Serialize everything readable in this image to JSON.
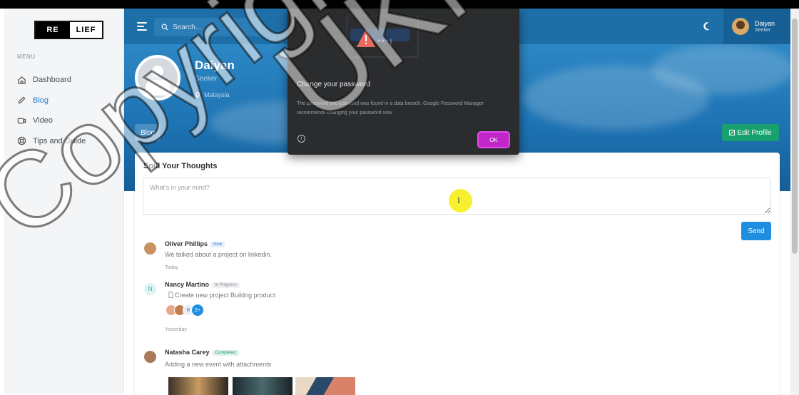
{
  "logo": {
    "left": "RE",
    "right": "LIEF"
  },
  "sidebar": {
    "menu_heading": "MENU",
    "items": [
      {
        "label": "Dashboard",
        "icon": "home-icon",
        "active": false
      },
      {
        "label": "Blog",
        "icon": "pencil-icon",
        "active": true
      },
      {
        "label": "Video",
        "icon": "video-icon",
        "active": false
      },
      {
        "label": "Tips and Guide",
        "icon": "lifebuoy-icon",
        "active": false
      }
    ]
  },
  "header": {
    "search_placeholder": "Search...",
    "user": {
      "name": "Daiyan",
      "role": "Seeker"
    }
  },
  "profile": {
    "name": "Daiyan",
    "role": "Seeker",
    "location": "Malaysia",
    "tab_label": "Blog",
    "edit_label": "Edit Profile"
  },
  "post_box": {
    "title": "Spill Your Thoughts",
    "placeholder": "What's in your mind?",
    "send_label": "Send"
  },
  "feed": [
    {
      "name": "Oliver Phillips",
      "badge": "New",
      "badge_color": "#e3effc",
      "badge_text": "#3b7ddd",
      "message": "We talked about a project on linkedin.",
      "time": "Today"
    },
    {
      "name": "Nancy Martino",
      "badge": "In Progress",
      "badge_color": "#eef0f2",
      "badge_text": "#8a8f96",
      "message": "Create new project Buildng product",
      "time": "Yesterday",
      "avatar_letter": "N",
      "stack_letter": "R",
      "stack_more": "2+"
    },
    {
      "name": "Natasha Carey",
      "badge": "Completed",
      "badge_color": "#dff3ea",
      "badge_text": "#1f9d6b",
      "message": "Adding a new event with attachments"
    }
  ],
  "dialog": {
    "masked_password": "***|",
    "title": "Change your password",
    "message": "The password you just used was found in a data breach. Google Password Manager recommends changing your password now.",
    "ok_label": "OK",
    "info_symbol": "i"
  },
  "watermark": {
    "line1": "Copyright",
    "line2": "UKM"
  },
  "colors": {
    "header": "#1e6fa8",
    "accent": "#1f8ee0",
    "edit_button": "#18a06e",
    "ok_button": "#c026c8"
  }
}
